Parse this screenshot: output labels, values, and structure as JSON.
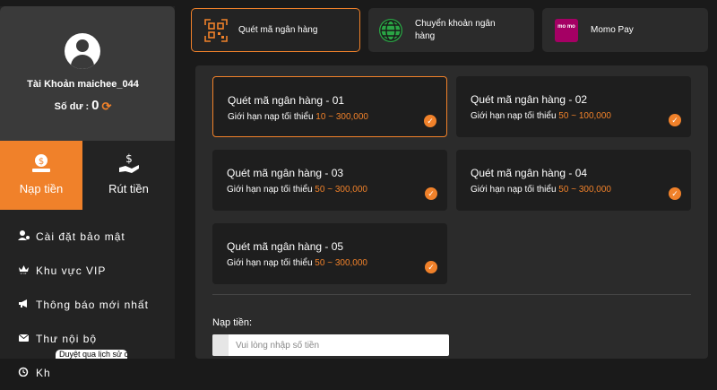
{
  "profile": {
    "account_label": "Tài Khoản maichee_044",
    "balance_label": "Số dư :",
    "balance_value": "0"
  },
  "actions": {
    "deposit": "Nạp tiền",
    "withdraw": "Rút tiền"
  },
  "menu": {
    "items": [
      {
        "label": "Cài đặt bảo mật",
        "icon": "user-gear-icon"
      },
      {
        "label": "Khu vực VIP",
        "icon": "vip-crown-icon"
      },
      {
        "label": "Thông báo mới nhất",
        "icon": "megaphone-icon"
      },
      {
        "label": "Thư nội bộ",
        "icon": "envelope-icon"
      },
      {
        "label": "Kh",
        "icon": "history-icon"
      }
    ],
    "tooltip": "Duyệt qua lịch sử c"
  },
  "methods": [
    {
      "label": "Quét mã ngân hàng",
      "icon": "qr-code-icon",
      "active": true
    },
    {
      "label": "Chuyển khoản ngân hàng",
      "icon": "globe-icon",
      "active": false
    },
    {
      "label": "Momo Pay",
      "icon": "momo-icon",
      "active": false,
      "logo_text": "mo mo"
    }
  ],
  "cards": [
    {
      "title": "Quét mã ngân hàng - 01",
      "limit_label": "Giới hạn nạp tối thiểu",
      "min": "10",
      "sep": "~",
      "max": "300,000",
      "selected": true
    },
    {
      "title": "Quét mã ngân hàng - 02",
      "limit_label": "Giới hạn nạp tối thiểu",
      "min": "50",
      "sep": "~",
      "max": "100,000",
      "selected": false
    },
    {
      "title": "Quét mã ngân hàng - 03",
      "limit_label": "Giới hạn nạp tối thiểu",
      "min": "50",
      "sep": "~",
      "max": "300,000",
      "selected": false
    },
    {
      "title": "Quét mã ngân hàng - 04",
      "limit_label": "Giới hạn nạp tối thiểu",
      "min": "50",
      "sep": "~",
      "max": "300,000",
      "selected": false
    },
    {
      "title": "Quét mã ngân hàng - 05",
      "limit_label": "Giới hạn nạp tối thiểu",
      "min": "50",
      "sep": "~",
      "max": "300,000",
      "selected": false
    }
  ],
  "amount": {
    "label": "Nạp tiền:",
    "placeholder": "Vui lòng nhập số tiền"
  },
  "colors": {
    "accent": "#f0812a",
    "sidebar_bg": "#232323",
    "panel_bg": "#2b2b2b"
  }
}
